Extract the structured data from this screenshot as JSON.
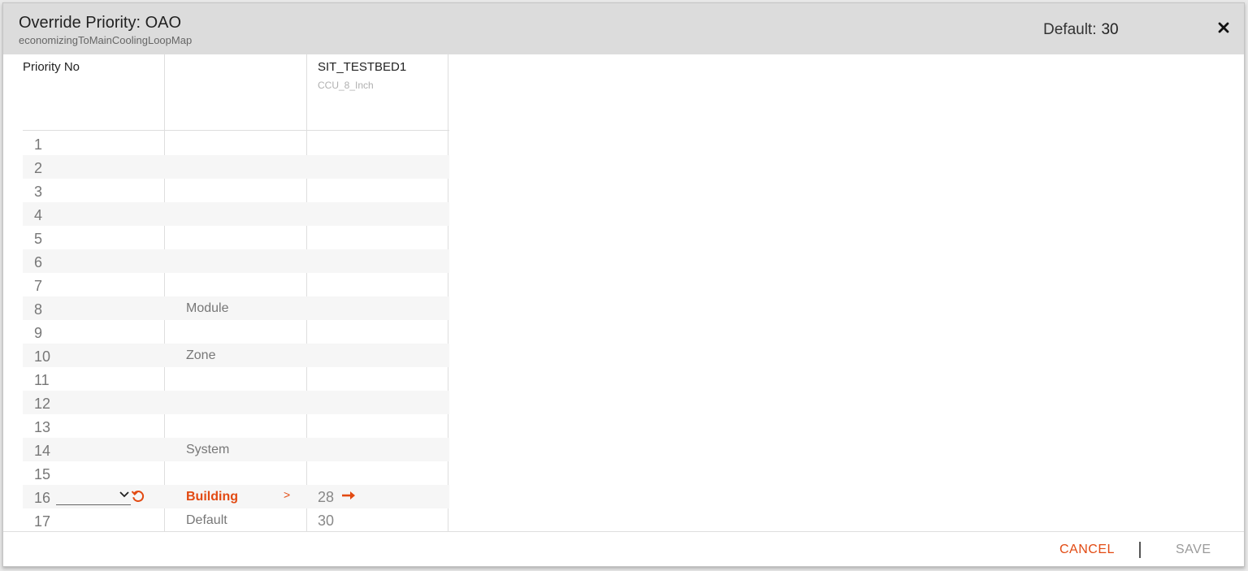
{
  "header": {
    "title": "Override Priority: OAO",
    "subtitle": "economizingToMainCoolingLoopMap",
    "default_label": "Default:",
    "default_value": "30"
  },
  "table": {
    "col1_header": "Priority No",
    "col3_header": "SIT_TESTBED1",
    "col3_subheader": "CCU_8_Inch",
    "rows": [
      {
        "no": "1",
        "level": "",
        "value": ""
      },
      {
        "no": "2",
        "level": "",
        "value": ""
      },
      {
        "no": "3",
        "level": "",
        "value": ""
      },
      {
        "no": "4",
        "level": "",
        "value": ""
      },
      {
        "no": "5",
        "level": "",
        "value": ""
      },
      {
        "no": "6",
        "level": "",
        "value": ""
      },
      {
        "no": "7",
        "level": "",
        "value": ""
      },
      {
        "no": "8",
        "level": "Module",
        "value": ""
      },
      {
        "no": "9",
        "level": "",
        "value": ""
      },
      {
        "no": "10",
        "level": "Zone",
        "value": ""
      },
      {
        "no": "11",
        "level": "",
        "value": ""
      },
      {
        "no": "12",
        "level": "",
        "value": ""
      },
      {
        "no": "13",
        "level": "",
        "value": ""
      },
      {
        "no": "14",
        "level": "System",
        "value": ""
      },
      {
        "no": "15",
        "level": "",
        "value": ""
      },
      {
        "no": "16",
        "level": "Building",
        "chevron": ">",
        "value": "28",
        "select_value": ""
      },
      {
        "no": "17",
        "level": "Default",
        "value": "30"
      }
    ]
  },
  "footer": {
    "cancel_label": "CANCEL",
    "save_label": "SAVE"
  },
  "colors": {
    "accent": "#e24a12",
    "header_bg": "#dcdcdc",
    "row_alt": "#f6f6f6"
  },
  "icons": {
    "close": "close-icon",
    "dropdown": "chevron-down-icon",
    "reset": "reset-icon",
    "arrow": "arrow-right-icon"
  }
}
